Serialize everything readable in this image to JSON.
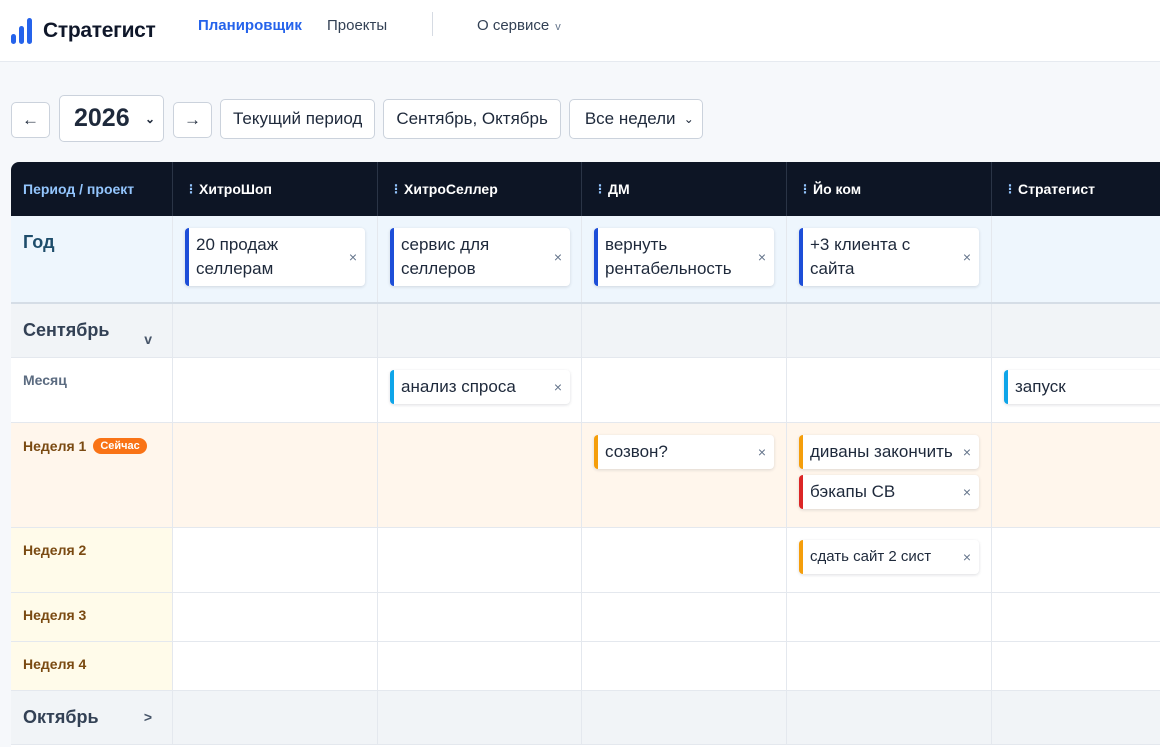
{
  "brand": {
    "name": "Стратегист"
  },
  "nav": {
    "planner": "Планировщик",
    "projects": "Проекты",
    "about": "О сервисе",
    "about_caret": "v"
  },
  "toolbar": {
    "prev": "←",
    "year": "2026",
    "next": "→",
    "current_period": "Текущий период",
    "period_range": "Сентябрь, Октябрь",
    "weeks_filter": "Все недели"
  },
  "grid": {
    "header": {
      "period_project": "Период / проект",
      "projects": [
        "ХитроШоп",
        "ХитроСеллер",
        "ДМ",
        "Йо ком",
        "Стратегист"
      ]
    },
    "year": {
      "label": "Год",
      "cards": [
        "20 продаж селлерам",
        "сервис для селлеров",
        "вернуть рентабельность",
        "+3 клиента с сайта"
      ]
    },
    "september": {
      "label": "Сентябрь",
      "caret": "v",
      "month_label": "Месяц",
      "month_cards": [
        "анализ спроса",
        "запуск"
      ],
      "week1": {
        "label": "Неделя 1",
        "badge": "Сейчас",
        "cards": [
          "созвон?",
          "диваны закончить",
          "бэкапы СВ"
        ]
      },
      "week2": {
        "label": "Неделя 2",
        "cards": [
          "сдать сайт 2 сист"
        ]
      },
      "week3": {
        "label": "Неделя 3"
      },
      "week4": {
        "label": "Неделя 4"
      }
    },
    "october": {
      "label": "Октябрь",
      "caret": ">"
    },
    "remove_icon": "×"
  },
  "colors": {
    "accent": "#2563eb",
    "header_bg": "#0d1525",
    "now_badge": "#f97316",
    "card_blue": "#1d4ed8",
    "card_cyan": "#0ea5e9",
    "card_orange": "#f59e0b",
    "card_red": "#dc2626"
  }
}
